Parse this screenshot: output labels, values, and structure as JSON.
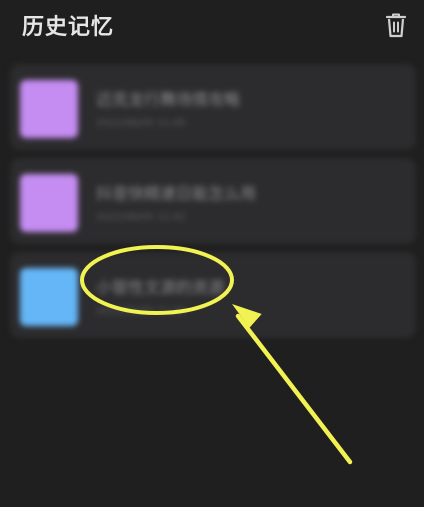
{
  "header": {
    "title": "历史记忆",
    "delete_icon": "trash-icon"
  },
  "history_items": [
    {
      "title": "迈克龙行舞场情攻略",
      "subtitle": "2022/06/05 11:45",
      "thumb_color": "#c58cf2"
    },
    {
      "title": "抖音快精速日能怎么用",
      "subtitle": "2022/06/05 11:42",
      "thumb_color": "#c58cf2"
    },
    {
      "title": "小管性文源的资源",
      "subtitle": "2022/06/05 11:40",
      "thumb_color": "#64b6f7"
    }
  ],
  "colors": {
    "background": "#1f1f1f",
    "card": "#2c2c2e",
    "annotation": "#f2f253"
  }
}
